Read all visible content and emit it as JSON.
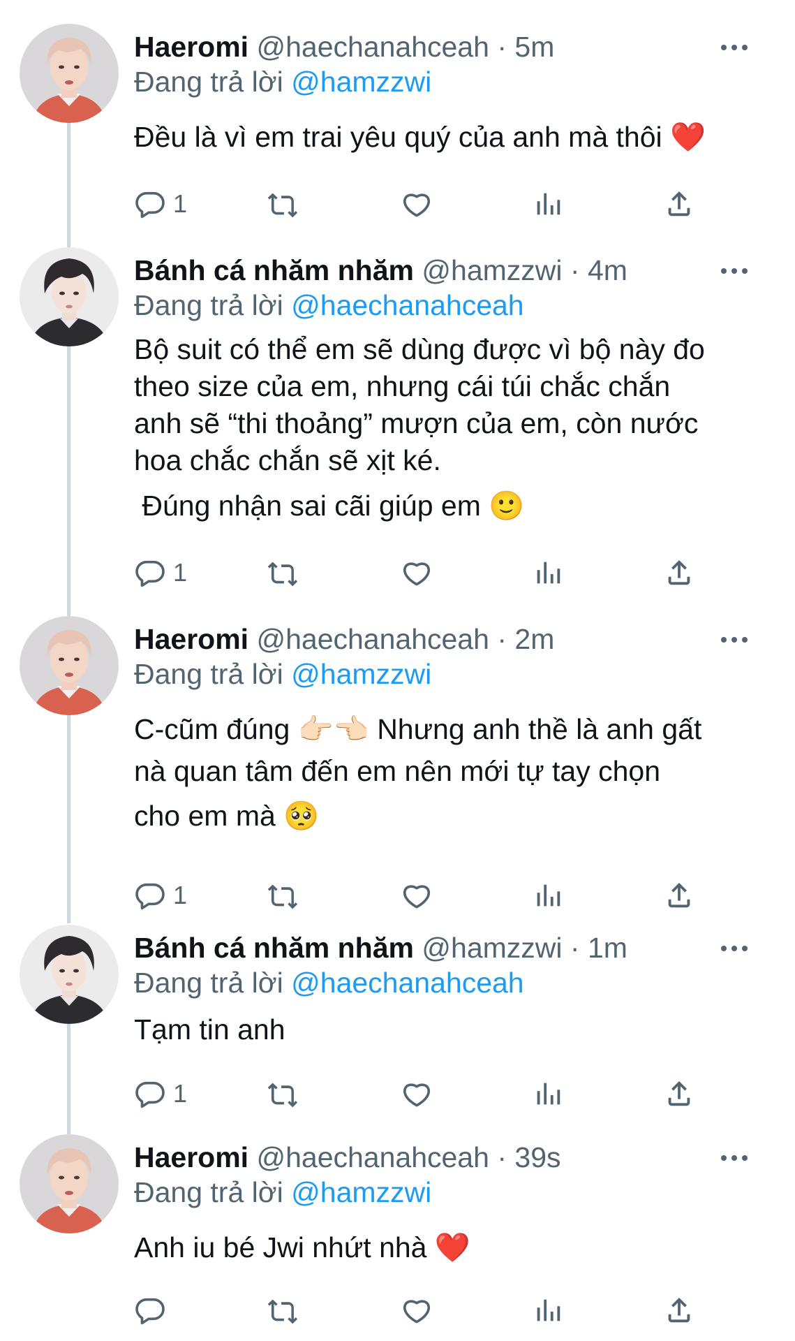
{
  "reply_prefix": "Đang trả lời",
  "tweets": [
    {
      "name": "Haeromi",
      "handle": "@haechanahceah",
      "time": "5m",
      "reply_to": "@hamzzwi",
      "lines": [
        "Đều là vì em trai yêu quý của anh mà thôi ❤️"
      ],
      "reply_count": "1"
    },
    {
      "name": "Bánh cá nhăm nhăm",
      "handle": "@hamzzwi",
      "time": "4m",
      "reply_to": "@haechanahceah",
      "lines": [
        "Bộ suit có thể em sẽ dùng được vì bộ này đo",
        "theo size của em, nhưng cái túi chắc chắn",
        "anh sẽ “thi thoảng” mượn của em, còn nước",
        "hoa chắc chắn sẽ xịt ké.",
        " Đúng nhận sai cãi giúp em 🙂"
      ],
      "reply_count": "1"
    },
    {
      "name": "Haeromi",
      "handle": "@haechanahceah",
      "time": "2m",
      "reply_to": "@hamzzwi",
      "lines": [
        "C-cũm đúng 👉🏻👈🏻 Nhưng anh thề là anh gất",
        "nà quan tâm đến em nên mới tự tay chọn",
        "cho em mà 🥺"
      ],
      "reply_count": "1"
    },
    {
      "name": "Bánh cá nhăm nhăm",
      "handle": "@hamzzwi",
      "time": "1m",
      "reply_to": "@haechanahceah",
      "lines": [
        "Tạm tin anh"
      ],
      "reply_count": "1"
    },
    {
      "name": "Haeromi",
      "handle": "@haechanahceah",
      "time": "39s",
      "reply_to": "@hamzzwi",
      "lines": [
        "Anh iu bé Jwi nhứt nhà ❤️"
      ],
      "reply_count": ""
    }
  ],
  "icons": {
    "reply": "reply-icon",
    "retweet": "retweet-icon",
    "like": "heart-icon",
    "views": "views-icon",
    "share": "share-icon",
    "more": "more-icon"
  },
  "colors": {
    "link": "#1d9bf0",
    "muted": "#536471",
    "text": "#0f1419",
    "line": "#cfd9de"
  }
}
